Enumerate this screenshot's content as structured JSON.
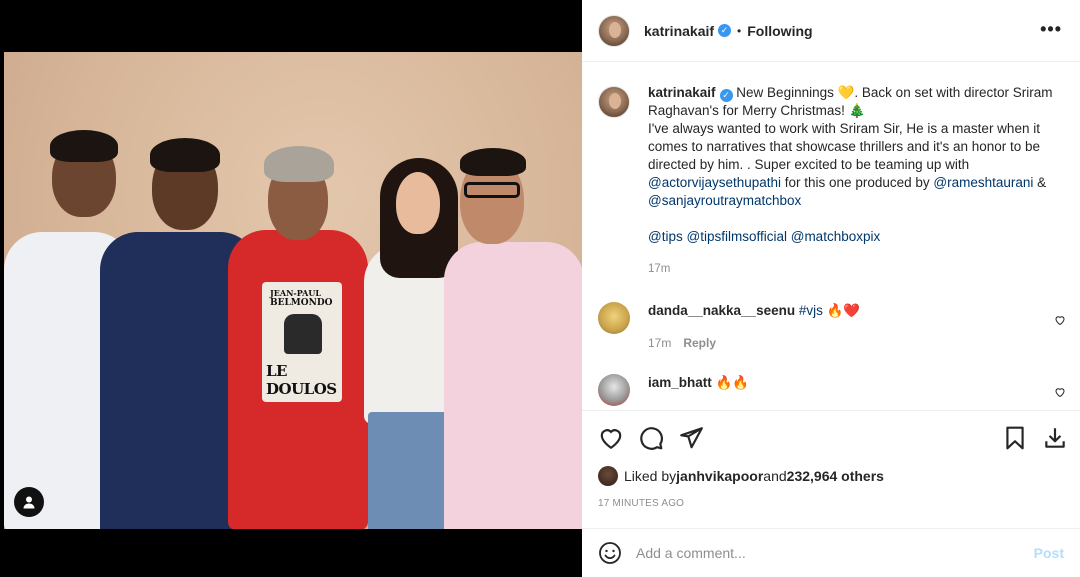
{
  "post": {
    "author": "katrinakaif",
    "follow_status": "Following",
    "separator": "•",
    "more": "•••"
  },
  "caption": {
    "author": "katrinakaif",
    "line1": " New Beginnings 💛. Back on set with director Sriram Raghavan's for Merry Christmas! 🎄",
    "line2": "I've always wanted to work with Sriram Sir, He is a master when it comes to narratives that showcase thrillers and it's an honor to be directed by him. . Super excited to be teaming up with ",
    "mention1": "@actorvijaysethupathi",
    "mid": " for this one produced by ",
    "mention2": "@rameshtaurani",
    "amp": " & ",
    "mention3": "@sanjayroutraymatchbox",
    "tag1": "@tips",
    "tag2": "@tipsfilmsofficial",
    "tag3": "@matchboxpix",
    "time": "17m"
  },
  "comments": [
    {
      "user": "danda__nakka__seenu",
      "text_link": "#vjs",
      "emoji": " 🔥❤️",
      "time": "17m",
      "reply": "Reply"
    },
    {
      "user": "iam_bhatt",
      "emoji": " 🔥🔥"
    }
  ],
  "likes": {
    "prefix": "Liked by ",
    "user": "janhvikapoor",
    "and": " and ",
    "count": "232,964 others"
  },
  "timestamp": "17 MINUTES AGO",
  "composer": {
    "placeholder": "Add a comment...",
    "post_label": "Post"
  },
  "shirt": {
    "line1": "JEAN-PAUL",
    "line2": "BELMONDO",
    "line3": "LE DOULOS"
  },
  "colors": {
    "verified": "#3897f0",
    "link": "#00376b",
    "post_disabled": "#b2dffc"
  }
}
